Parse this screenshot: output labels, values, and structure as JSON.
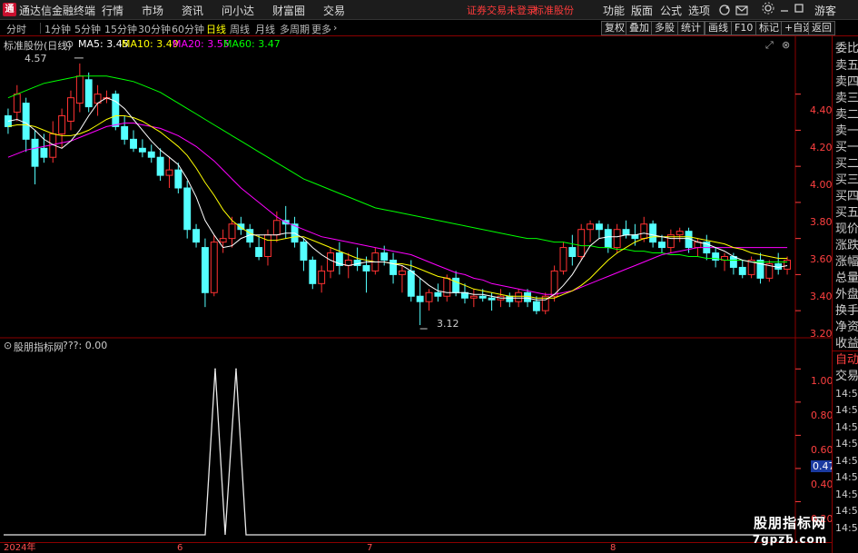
{
  "app": {
    "title": "通达信金融终端",
    "logo_glyph": "通"
  },
  "menu": [
    "行情",
    "市场",
    "资讯",
    "问小达",
    "财富圈",
    "交易"
  ],
  "login_status": "证券交易未登录",
  "stock_name": "标准股份",
  "right_menu": [
    "功能",
    "版面",
    "公式",
    "选项"
  ],
  "guest": "游客",
  "periods": [
    "分时",
    "1分钟",
    "5分钟",
    "15分钟",
    "30分钟",
    "60分钟",
    "日线",
    "周线",
    "月线",
    "多周期",
    "更多"
  ],
  "active_period": "日线",
  "right_buttons": [
    "复权",
    "叠加",
    "多股",
    "统计",
    "画线",
    "F10",
    "标记",
    "+自选",
    "返回"
  ],
  "main_legend": {
    "title": "标准股份(日线)",
    "ma5": "MA5: 3.45",
    "ma10": "MA10: 3.49",
    "ma20": "MA20: 3.55",
    "ma60": "MA60: 3.47"
  },
  "colors": {
    "up": "#ff3232",
    "down": "#54ffff",
    "ma5": "#ffffff",
    "ma10": "#ffff00",
    "ma20": "#ff00ff",
    "ma60": "#00ff00",
    "grid": "#8b0000"
  },
  "price_axis": [
    "4.40",
    "4.20",
    "4.00",
    "3.80",
    "3.60",
    "3.40",
    "3.20"
  ],
  "high_marker": "4.57",
  "low_marker": "3.12",
  "indicator_legend": {
    "title": "股朋指标网",
    "value": "???: 0.00"
  },
  "indicator_axis": [
    "1.00",
    "0.80",
    "0.60",
    "0.40",
    "0.20"
  ],
  "indicator_cursor_value": "0.47",
  "dates": [
    "2024年",
    "6",
    "7",
    "8"
  ],
  "quote_panel": [
    "委比",
    "卖五",
    "卖四",
    "卖三",
    "卖二",
    "卖一",
    "买一",
    "买二",
    "买三",
    "买四",
    "买五",
    "现价",
    "涨跌",
    "涨幅",
    "总量",
    "外盘",
    "换手",
    "净资",
    "收益"
  ],
  "trade_panel": [
    "自动",
    "交易"
  ],
  "tick_times": [
    "14:56",
    "14:56",
    "14:56",
    "14:56",
    "14:56",
    "14:56",
    "14:56",
    "14:56",
    "14:56"
  ],
  "watermark": {
    "cn": "股朋指标网",
    "url": "7gpzb.com"
  },
  "chart_data": [
    {
      "type": "candlestick",
      "title": "标准股份(日线)",
      "ylim": [
        3.1,
        4.65
      ],
      "candles": [
        [
          4.28,
          4.32,
          4.18,
          4.22
        ],
        [
          4.3,
          4.45,
          4.25,
          4.4
        ],
        [
          4.35,
          4.38,
          4.08,
          4.15
        ],
        [
          4.15,
          4.2,
          3.9,
          4.0
        ],
        [
          4.1,
          4.18,
          4.02,
          4.05
        ],
        [
          4.05,
          4.25,
          4.02,
          4.18
        ],
        [
          4.18,
          4.32,
          4.1,
          4.28
        ],
        [
          4.25,
          4.42,
          4.2,
          4.38
        ],
        [
          4.35,
          4.57,
          4.3,
          4.5
        ],
        [
          4.48,
          4.52,
          4.3,
          4.33
        ],
        [
          4.35,
          4.45,
          4.28,
          4.4
        ],
        [
          4.38,
          4.42,
          4.35,
          4.38
        ],
        [
          4.4,
          4.42,
          4.2,
          4.22
        ],
        [
          4.22,
          4.28,
          4.12,
          4.15
        ],
        [
          4.15,
          4.2,
          4.08,
          4.1
        ],
        [
          4.1,
          4.15,
          4.05,
          4.08
        ],
        [
          4.08,
          4.12,
          4.02,
          4.05
        ],
        [
          4.05,
          4.1,
          3.92,
          3.95
        ],
        [
          3.95,
          4.05,
          3.88,
          3.98
        ],
        [
          3.98,
          4.02,
          3.85,
          3.88
        ],
        [
          3.88,
          3.92,
          3.6,
          3.65
        ],
        [
          3.65,
          3.68,
          3.55,
          3.58
        ],
        [
          3.55,
          3.6,
          3.22,
          3.3
        ],
        [
          3.3,
          3.62,
          3.28,
          3.58
        ],
        [
          3.58,
          3.65,
          3.52,
          3.6
        ],
        [
          3.6,
          3.72,
          3.55,
          3.68
        ],
        [
          3.68,
          3.72,
          3.62,
          3.65
        ],
        [
          3.65,
          3.68,
          3.55,
          3.58
        ],
        [
          3.55,
          3.62,
          3.48,
          3.5
        ],
        [
          3.5,
          3.65,
          3.45,
          3.62
        ],
        [
          3.62,
          3.75,
          3.58,
          3.7
        ],
        [
          3.7,
          3.78,
          3.6,
          3.68
        ],
        [
          3.68,
          3.72,
          3.55,
          3.58
        ],
        [
          3.58,
          3.6,
          3.42,
          3.48
        ],
        [
          3.48,
          3.5,
          3.32,
          3.35
        ],
        [
          3.35,
          3.45,
          3.3,
          3.42
        ],
        [
          3.42,
          3.55,
          3.38,
          3.52
        ],
        [
          3.52,
          3.58,
          3.4,
          3.45
        ],
        [
          3.45,
          3.52,
          3.38,
          3.48
        ],
        [
          3.48,
          3.55,
          3.42,
          3.45
        ],
        [
          3.45,
          3.5,
          3.3,
          3.42
        ],
        [
          3.42,
          3.55,
          3.4,
          3.52
        ],
        [
          3.52,
          3.56,
          3.45,
          3.48
        ],
        [
          3.48,
          3.52,
          3.35,
          3.4
        ],
        [
          3.4,
          3.45,
          3.3,
          3.42
        ],
        [
          3.42,
          3.48,
          3.25,
          3.28
        ],
        [
          3.28,
          3.38,
          3.12,
          3.25
        ],
        [
          3.25,
          3.32,
          3.2,
          3.3
        ],
        [
          3.3,
          3.35,
          3.25,
          3.28
        ],
        [
          3.28,
          3.4,
          3.25,
          3.38
        ],
        [
          3.38,
          3.42,
          3.28,
          3.3
        ],
        [
          3.3,
          3.35,
          3.24,
          3.27
        ],
        [
          3.27,
          3.32,
          3.22,
          3.28
        ],
        [
          3.28,
          3.32,
          3.25,
          3.27
        ],
        [
          3.27,
          3.3,
          3.2,
          3.26
        ],
        [
          3.26,
          3.32,
          3.22,
          3.28
        ],
        [
          3.28,
          3.3,
          3.22,
          3.25
        ],
        [
          3.25,
          3.32,
          3.22,
          3.3
        ],
        [
          3.3,
          3.32,
          3.22,
          3.25
        ],
        [
          3.25,
          3.28,
          3.18,
          3.2
        ],
        [
          3.2,
          3.3,
          3.18,
          3.28
        ],
        [
          3.28,
          3.45,
          3.25,
          3.42
        ],
        [
          3.42,
          3.58,
          3.4,
          3.55
        ],
        [
          3.55,
          3.62,
          3.45,
          3.5
        ],
        [
          3.5,
          3.68,
          3.48,
          3.65
        ],
        [
          3.65,
          3.7,
          3.58,
          3.68
        ],
        [
          3.68,
          3.7,
          3.6,
          3.65
        ],
        [
          3.65,
          3.68,
          3.52,
          3.55
        ],
        [
          3.55,
          3.68,
          3.52,
          3.65
        ],
        [
          3.65,
          3.7,
          3.6,
          3.62
        ],
        [
          3.62,
          3.68,
          3.56,
          3.6
        ],
        [
          3.6,
          3.72,
          3.58,
          3.68
        ],
        [
          3.68,
          3.7,
          3.55,
          3.58
        ],
        [
          3.58,
          3.62,
          3.52,
          3.55
        ],
        [
          3.55,
          3.65,
          3.52,
          3.62
        ],
        [
          3.62,
          3.66,
          3.58,
          3.64
        ],
        [
          3.64,
          3.66,
          3.52,
          3.55
        ],
        [
          3.55,
          3.6,
          3.5,
          3.58
        ],
        [
          3.58,
          3.62,
          3.48,
          3.52
        ],
        [
          3.52,
          3.55,
          3.44,
          3.48
        ],
        [
          3.48,
          3.52,
          3.42,
          3.5
        ],
        [
          3.5,
          3.52,
          3.4,
          3.44
        ],
        [
          3.44,
          3.48,
          3.38,
          3.4
        ],
        [
          3.4,
          3.5,
          3.38,
          3.48
        ],
        [
          3.48,
          3.52,
          3.35,
          3.38
        ],
        [
          3.38,
          3.48,
          3.36,
          3.46
        ],
        [
          3.46,
          3.52,
          3.4,
          3.43
        ],
        [
          3.43,
          3.5,
          3.4,
          3.48
        ]
      ],
      "ma5": [
        4.25,
        4.26,
        4.24,
        4.2,
        4.15,
        4.12,
        4.1,
        4.14,
        4.2,
        4.28,
        4.35,
        4.38,
        4.36,
        4.32,
        4.26,
        4.2,
        4.14,
        4.09,
        4.05,
        4.01,
        3.93,
        3.83,
        3.7,
        3.62,
        3.55,
        3.56,
        3.6,
        3.62,
        3.62,
        3.62,
        3.62,
        3.63,
        3.63,
        3.6,
        3.55,
        3.51,
        3.48,
        3.46,
        3.45,
        3.46,
        3.47,
        3.47,
        3.47,
        3.46,
        3.45,
        3.42,
        3.38,
        3.34,
        3.31,
        3.3,
        3.3,
        3.3,
        3.29,
        3.29,
        3.28,
        3.27,
        3.27,
        3.27,
        3.27,
        3.26,
        3.26,
        3.29,
        3.34,
        3.4,
        3.48,
        3.56,
        3.6,
        3.61,
        3.61,
        3.62,
        3.62,
        3.63,
        3.62,
        3.61,
        3.6,
        3.6,
        3.6,
        3.58,
        3.57,
        3.55,
        3.53,
        3.5,
        3.48,
        3.47,
        3.46,
        3.45,
        3.44,
        3.45
      ],
      "ma10": [
        4.22,
        4.23,
        4.23,
        4.22,
        4.2,
        4.18,
        4.17,
        4.17,
        4.18,
        4.2,
        4.23,
        4.26,
        4.28,
        4.28,
        4.27,
        4.25,
        4.22,
        4.19,
        4.15,
        4.11,
        4.06,
        3.99,
        3.91,
        3.84,
        3.76,
        3.7,
        3.66,
        3.63,
        3.61,
        3.59,
        3.59,
        3.6,
        3.61,
        3.61,
        3.59,
        3.57,
        3.55,
        3.53,
        3.51,
        3.49,
        3.48,
        3.47,
        3.47,
        3.46,
        3.46,
        3.45,
        3.43,
        3.41,
        3.39,
        3.38,
        3.36,
        3.34,
        3.32,
        3.31,
        3.3,
        3.29,
        3.28,
        3.28,
        3.28,
        3.27,
        3.27,
        3.27,
        3.29,
        3.31,
        3.34,
        3.38,
        3.43,
        3.48,
        3.52,
        3.55,
        3.58,
        3.6,
        3.61,
        3.61,
        3.61,
        3.61,
        3.61,
        3.6,
        3.59,
        3.58,
        3.57,
        3.55,
        3.54,
        3.52,
        3.51,
        3.5,
        3.49,
        3.49
      ],
      "ma20": [
        4.05,
        4.07,
        4.09,
        4.1,
        4.11,
        4.12,
        4.13,
        4.14,
        4.16,
        4.18,
        4.2,
        4.22,
        4.23,
        4.24,
        4.24,
        4.23,
        4.22,
        4.21,
        4.19,
        4.17,
        4.14,
        4.11,
        4.07,
        4.03,
        3.98,
        3.93,
        3.88,
        3.84,
        3.8,
        3.76,
        3.72,
        3.69,
        3.67,
        3.65,
        3.63,
        3.61,
        3.6,
        3.59,
        3.58,
        3.57,
        3.56,
        3.55,
        3.54,
        3.53,
        3.52,
        3.51,
        3.49,
        3.47,
        3.45,
        3.43,
        3.41,
        3.4,
        3.38,
        3.37,
        3.35,
        3.34,
        3.33,
        3.32,
        3.31,
        3.3,
        3.29,
        3.29,
        3.3,
        3.31,
        3.33,
        3.35,
        3.37,
        3.39,
        3.41,
        3.43,
        3.45,
        3.47,
        3.49,
        3.51,
        3.52,
        3.53,
        3.54,
        3.55,
        3.55,
        3.55,
        3.55,
        3.55,
        3.55,
        3.55,
        3.55,
        3.55,
        3.55,
        3.55
      ],
      "ma60": [
        4.38,
        4.4,
        4.42,
        4.44,
        4.46,
        4.47,
        4.48,
        4.49,
        4.5,
        4.5,
        4.5,
        4.5,
        4.49,
        4.48,
        4.47,
        4.45,
        4.43,
        4.41,
        4.38,
        4.35,
        4.32,
        4.29,
        4.26,
        4.23,
        4.2,
        4.17,
        4.14,
        4.11,
        4.08,
        4.05,
        4.02,
        3.99,
        3.96,
        3.93,
        3.91,
        3.89,
        3.87,
        3.85,
        3.83,
        3.81,
        3.79,
        3.77,
        3.76,
        3.75,
        3.74,
        3.73,
        3.72,
        3.71,
        3.7,
        3.69,
        3.68,
        3.67,
        3.66,
        3.65,
        3.64,
        3.63,
        3.62,
        3.61,
        3.6,
        3.6,
        3.59,
        3.58,
        3.58,
        3.57,
        3.56,
        3.56,
        3.55,
        3.55,
        3.54,
        3.54,
        3.53,
        3.53,
        3.52,
        3.52,
        3.51,
        3.51,
        3.5,
        3.5,
        3.49,
        3.49,
        3.48,
        3.48,
        3.48,
        3.47,
        3.47,
        3.47,
        3.47,
        3.47
      ]
    },
    {
      "type": "line",
      "title": "股朋指标网",
      "ylim": [
        0,
        1.1
      ],
      "x": [
        0,
        1,
        2,
        3,
        4,
        5,
        6,
        7,
        8
      ],
      "values": [
        0,
        0,
        1,
        0,
        1,
        0,
        0,
        0,
        0
      ]
    }
  ]
}
